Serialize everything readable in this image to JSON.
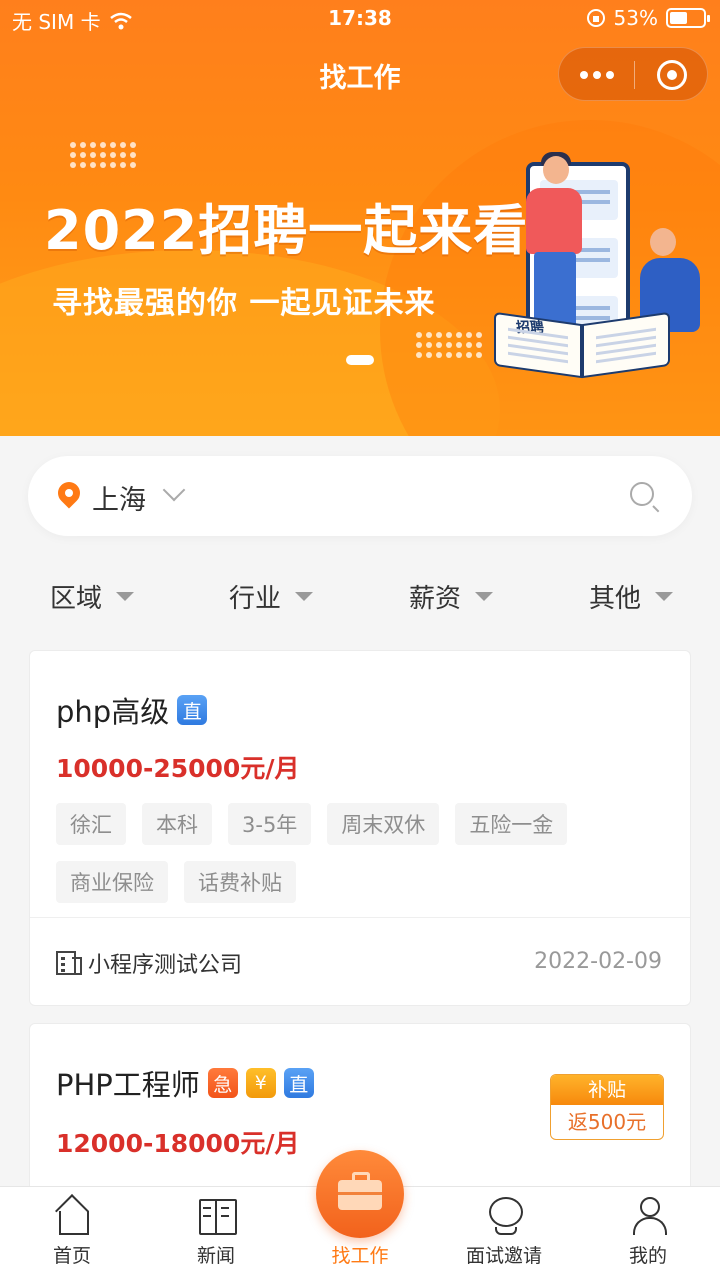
{
  "status_bar": {
    "carrier": "无 SIM 卡",
    "time": "17:38",
    "battery": "53%",
    "battery_level": 0.53
  },
  "nav": {
    "title": "找工作"
  },
  "banner": {
    "title": "2022招聘一起来看",
    "subtitle": "寻找最强的你  一起见证未来",
    "book_text": "招聘"
  },
  "search": {
    "city": "上海"
  },
  "filters": [
    {
      "label": "区域"
    },
    {
      "label": "行业"
    },
    {
      "label": "薪资"
    },
    {
      "label": "其他"
    }
  ],
  "jobs": [
    {
      "title": "php高级",
      "badges": [
        "直"
      ],
      "salary": "10000-25000元/月",
      "tags": [
        "徐汇",
        "本科",
        "3-5年",
        "周末双休",
        "五险一金",
        "商业保险",
        "话费补贴"
      ],
      "company": "小程序测试公司",
      "date": "2022-02-09"
    },
    {
      "title": "PHP工程师",
      "badges": [
        "急",
        "¥",
        "直"
      ],
      "salary": "12000-18000元/月",
      "subsidy": {
        "label": "补贴",
        "value": "返500元"
      }
    }
  ],
  "tabbar": [
    {
      "label": "首页",
      "icon": "home-icon"
    },
    {
      "label": "新闻",
      "icon": "news-icon"
    },
    {
      "label": "找工作",
      "icon": "briefcase-icon",
      "active": true
    },
    {
      "label": "面试邀请",
      "icon": "interview-icon"
    },
    {
      "label": "我的",
      "icon": "profile-icon"
    }
  ],
  "colors": {
    "accent": "#ff7a14",
    "salary": "#d9302a",
    "badge_direct": "#2f7ae0",
    "badge_urgent": "#f25419",
    "badge_money": "#f29a0b"
  }
}
